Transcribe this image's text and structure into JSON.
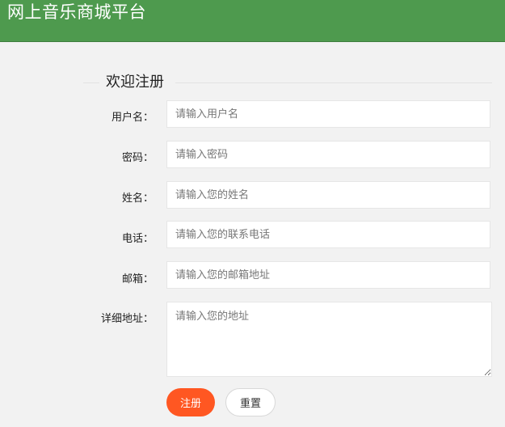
{
  "header": {
    "title": "网上音乐商城平台",
    "bg_color": "#4e9a4e"
  },
  "form": {
    "legend": "欢迎注册",
    "fields": [
      {
        "label": "用户名：",
        "placeholder": "请输入用户名",
        "value": ""
      },
      {
        "label": "密码：",
        "placeholder": "请输入密码",
        "value": ""
      },
      {
        "label": "姓名：",
        "placeholder": "请输入您的姓名",
        "value": ""
      },
      {
        "label": "电话：",
        "placeholder": "请输入您的联系电话",
        "value": ""
      },
      {
        "label": "邮箱：",
        "placeholder": "请输入您的邮箱地址",
        "value": ""
      },
      {
        "label": "详细地址：",
        "placeholder": "请输入您的地址",
        "value": ""
      }
    ],
    "submit_label": "注册",
    "reset_label": "重置",
    "submit_color": "#ff5722"
  }
}
